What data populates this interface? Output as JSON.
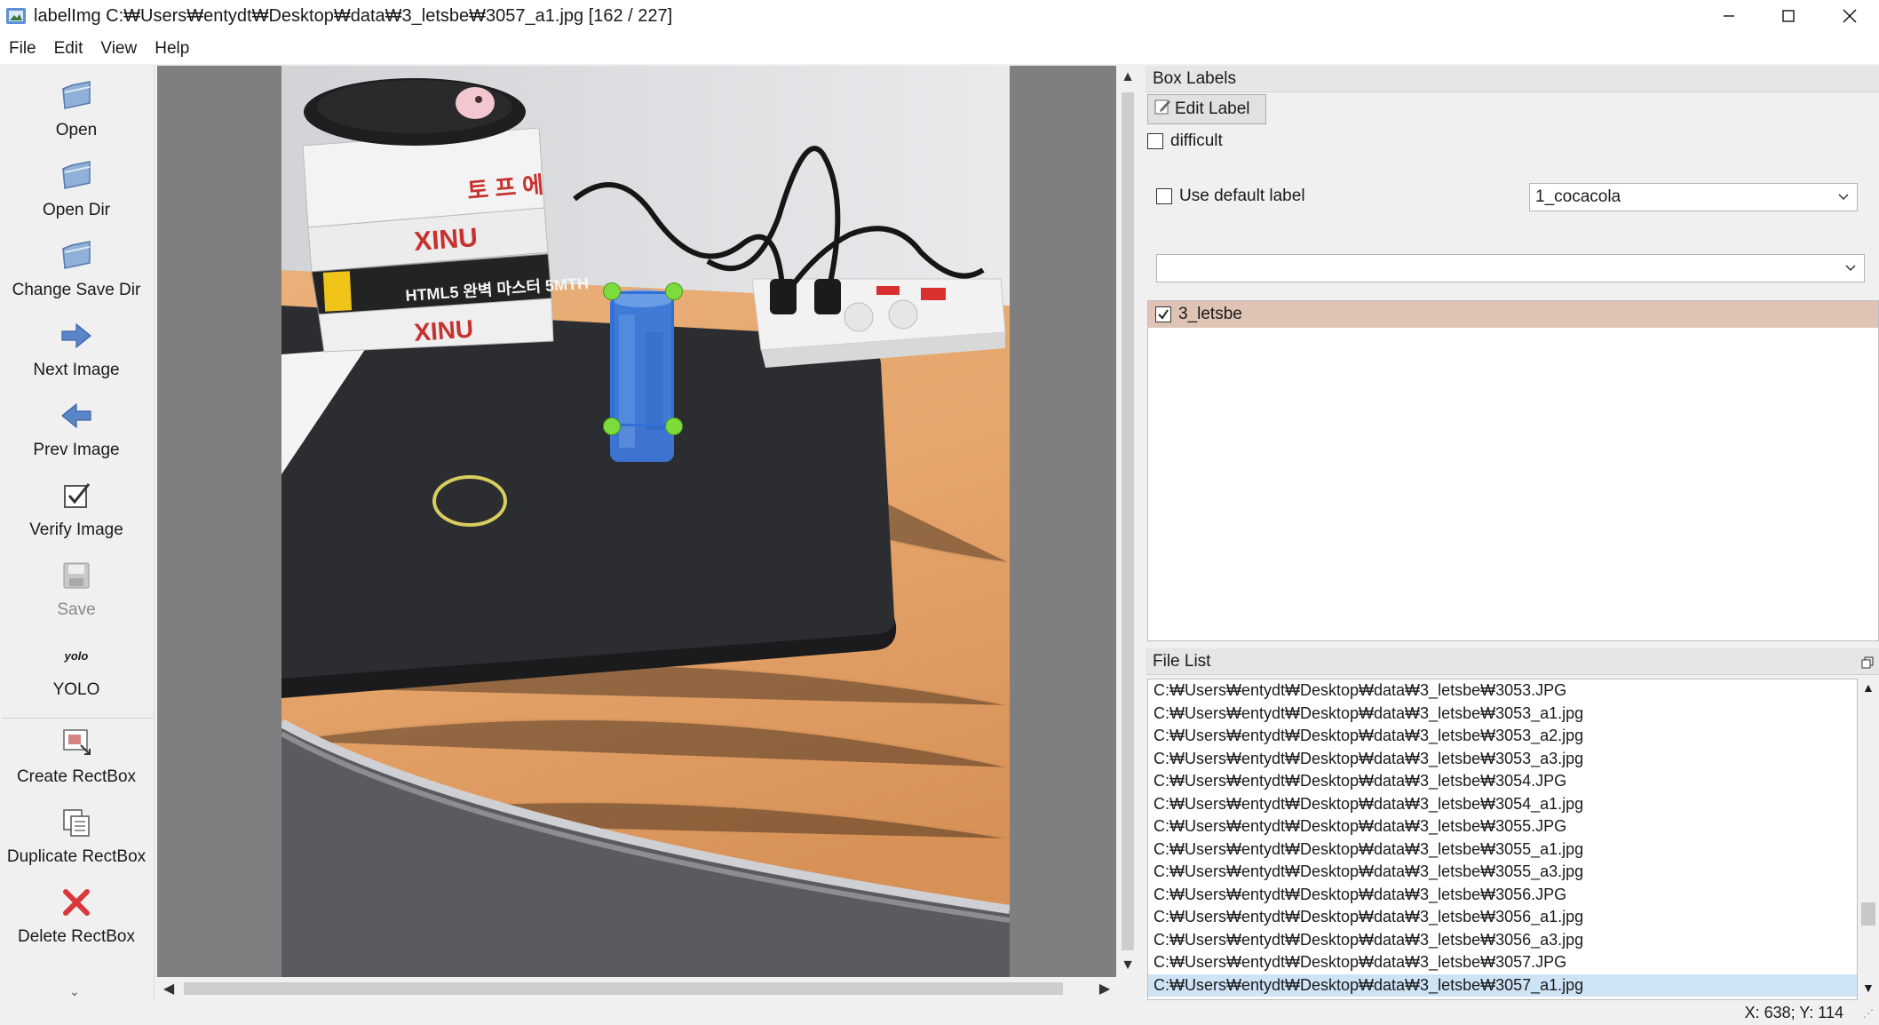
{
  "window": {
    "title": "labelImg C:₩Users₩entydt₩Desktop₩data₩3_letsbe₩3057_a1.jpg [162 / 227]",
    "controls": [
      "minimize",
      "maximize",
      "close"
    ]
  },
  "menu": [
    "File",
    "Edit",
    "View",
    "Help"
  ],
  "toolbar": {
    "open": "Open",
    "open_dir": "Open Dir",
    "change_save_dir": "Change Save Dir",
    "next_image": "Next Image",
    "prev_image": "Prev Image",
    "verify_image": "Verify Image",
    "save": "Save",
    "yolo_icon_text": "yolo",
    "yolo": "YOLO",
    "create_rectbox": "Create RectBox",
    "duplicate_rectbox": "Duplicate RectBox",
    "delete_rectbox": "Delete RectBox"
  },
  "box_labels": {
    "header": "Box Labels",
    "edit_label": "Edit Label",
    "difficult": "difficult",
    "difficult_checked": false,
    "use_default_label": "Use default label",
    "use_default_checked": false,
    "default_label_value": "1_cocacola",
    "second_combo_value": "",
    "labels": [
      {
        "name": "3_letsbe",
        "checked": true
      }
    ]
  },
  "file_list": {
    "header": "File List",
    "files": [
      "C:₩Users₩entydt₩Desktop₩data₩3_letsbe₩3053.JPG",
      "C:₩Users₩entydt₩Desktop₩data₩3_letsbe₩3053_a1.jpg",
      "C:₩Users₩entydt₩Desktop₩data₩3_letsbe₩3053_a2.jpg",
      "C:₩Users₩entydt₩Desktop₩data₩3_letsbe₩3053_a3.jpg",
      "C:₩Users₩entydt₩Desktop₩data₩3_letsbe₩3054.JPG",
      "C:₩Users₩entydt₩Desktop₩data₩3_letsbe₩3054_a1.jpg",
      "C:₩Users₩entydt₩Desktop₩data₩3_letsbe₩3055.JPG",
      "C:₩Users₩entydt₩Desktop₩data₩3_letsbe₩3055_a1.jpg",
      "C:₩Users₩entydt₩Desktop₩data₩3_letsbe₩3055_a3.jpg",
      "C:₩Users₩entydt₩Desktop₩data₩3_letsbe₩3056.JPG",
      "C:₩Users₩entydt₩Desktop₩data₩3_letsbe₩3056_a1.jpg",
      "C:₩Users₩entydt₩Desktop₩data₩3_letsbe₩3056_a3.jpg",
      "C:₩Users₩entydt₩Desktop₩data₩3_letsbe₩3057.JPG",
      "C:₩Users₩entydt₩Desktop₩data₩3_letsbe₩3057_a1.jpg"
    ],
    "selected_index": 13
  },
  "photo": {
    "book_labels": [
      "XINU",
      "HTML5 완벽 마스터 5MTH",
      "XINU",
      "토 프 에"
    ]
  },
  "status": {
    "coords": "X: 638; Y: 114"
  },
  "colors": {
    "accent_box": "#2f6fd6",
    "handle": "#7ddc3c",
    "selected_label_bg": "#dfc4b5",
    "selected_file_bg": "#cfe3f6",
    "canvas_bg": "#7f7f7f"
  }
}
